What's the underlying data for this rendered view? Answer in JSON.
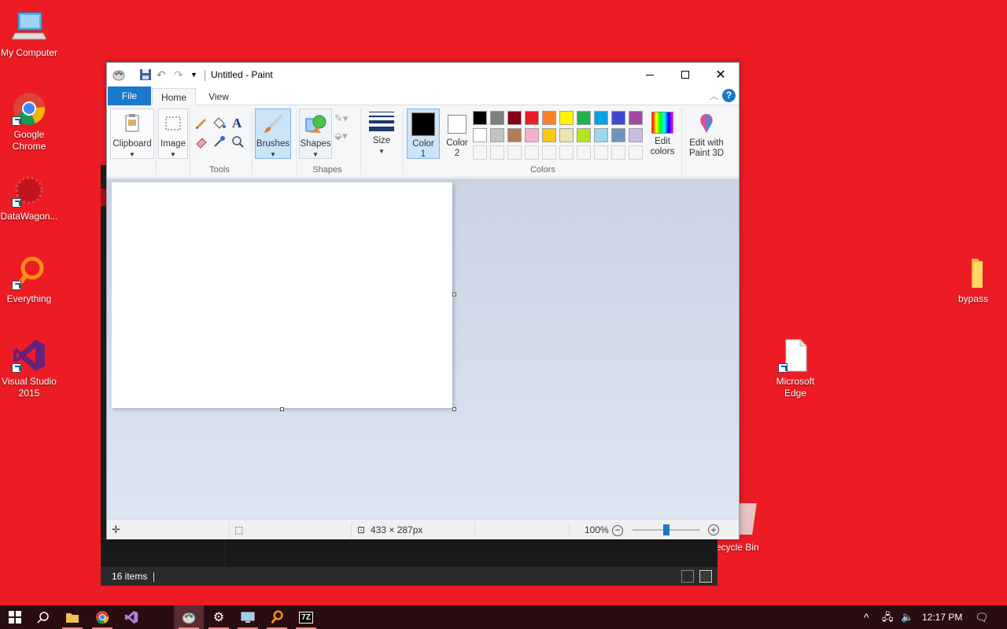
{
  "desktop": {
    "icons": [
      {
        "label": "My Computer"
      },
      {
        "label": "Google Chrome"
      },
      {
        "label": "DataWagon..."
      },
      {
        "label": "Everything"
      },
      {
        "label": "Visual Studio 2015"
      },
      {
        "label": "bypass"
      },
      {
        "label": "Microsoft Edge"
      },
      {
        "label": "Recycle Bin",
        "visible_text": "ecycle Bin"
      }
    ],
    "background_color": "#ED1C24"
  },
  "explorer": {
    "status_text": "16 items"
  },
  "paint": {
    "title": "Untitled - Paint",
    "tabs": {
      "file": "File",
      "home": "Home",
      "view": "View"
    },
    "help": "?",
    "ribbon": {
      "clipboard": "Clipboard",
      "image": "Image",
      "tools_label": "Tools",
      "brushes": "Brushes",
      "shapes": "Shapes",
      "shapes_label": "Shapes",
      "size": "Size",
      "color1": "Color 1",
      "color2": "Color 2",
      "colors_label": "Colors",
      "edit_colors": "Edit colors",
      "edit_paint3d": "Edit with Paint 3D",
      "text_tool": "A"
    },
    "palette_row1": [
      "#000000",
      "#7f7f7f",
      "#880015",
      "#ed1c24",
      "#ff7f27",
      "#fff200",
      "#22b14c",
      "#00a2e8",
      "#3f48cc",
      "#a349a4"
    ],
    "palette_row2": [
      "#ffffff",
      "#c3c3c3",
      "#b97a57",
      "#ffaec9",
      "#ffc90e",
      "#efe4b0",
      "#b5e61d",
      "#99d9ea",
      "#7092be",
      "#c8bfe7"
    ],
    "status": {
      "dimensions": "433 × 287px",
      "zoom": "100%",
      "zoom_level_fraction": 0.5
    }
  },
  "taskbar": {
    "time": "12:17 PM"
  }
}
